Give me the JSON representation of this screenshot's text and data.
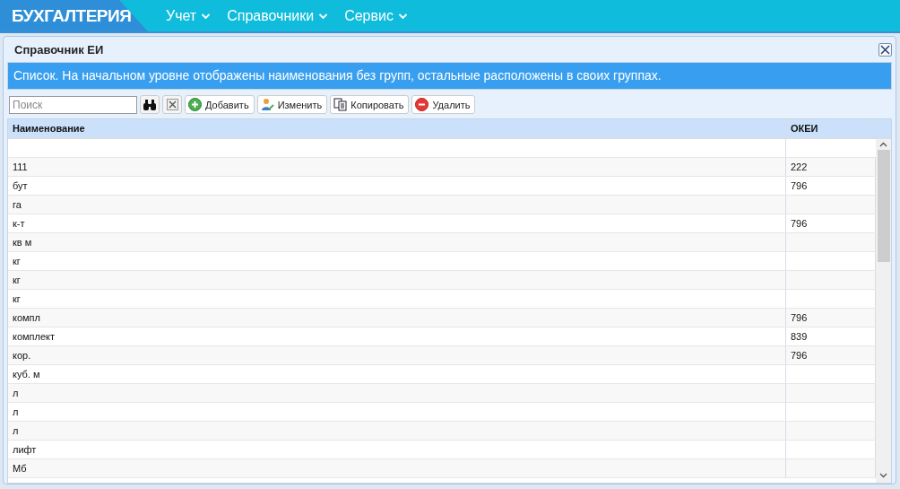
{
  "app": {
    "title": "БУХГАЛТЕРИЯ"
  },
  "menu": [
    {
      "label": "Учет"
    },
    {
      "label": "Справочники"
    },
    {
      "label": "Сервис"
    }
  ],
  "dialog": {
    "title": "Справочник ЕИ",
    "info": "Список. На начальном уровне отображены наименования без групп, остальные расположены в своих группах.",
    "search": {
      "placeholder": "Поиск"
    },
    "buttons": [
      {
        "kind": "add",
        "label": "Добавить"
      },
      {
        "kind": "edit",
        "label": "Изменить"
      },
      {
        "kind": "copy",
        "label": "Копировать"
      },
      {
        "kind": "delete",
        "label": "Удалить"
      }
    ],
    "table": {
      "columns": [
        "Наименование",
        "ОКЕИ"
      ],
      "rows": [
        [
          "111",
          "222"
        ],
        [
          "бут",
          "796"
        ],
        [
          "га"
        ],
        [
          "к-т",
          "796"
        ],
        [
          "кв м"
        ],
        [
          "кг"
        ],
        [
          "кг"
        ],
        [
          "кг"
        ],
        [
          "компл",
          "796"
        ],
        [
          "комплект",
          "839"
        ],
        [
          "кор.",
          "796"
        ],
        [
          "куб. м"
        ],
        [
          "л"
        ],
        [
          "л"
        ],
        [
          "л"
        ],
        [
          "лифт"
        ],
        [
          "Мб"
        ]
      ]
    }
  }
}
